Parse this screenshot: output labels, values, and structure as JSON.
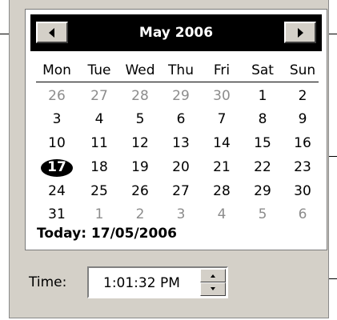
{
  "calendar": {
    "month_year": "May 2006",
    "prev_icon": "arrow-left-icon",
    "next_icon": "arrow-right-icon",
    "weekdays": [
      "Mon",
      "Tue",
      "Wed",
      "Thu",
      "Fri",
      "Sat",
      "Sun"
    ],
    "weeks": [
      [
        {
          "d": "26",
          "o": true
        },
        {
          "d": "27",
          "o": true
        },
        {
          "d": "28",
          "o": true
        },
        {
          "d": "29",
          "o": true
        },
        {
          "d": "30",
          "o": true
        },
        {
          "d": "1",
          "o": false
        },
        {
          "d": "2",
          "o": false
        }
      ],
      [
        {
          "d": "3",
          "o": false
        },
        {
          "d": "4",
          "o": false
        },
        {
          "d": "5",
          "o": false
        },
        {
          "d": "6",
          "o": false
        },
        {
          "d": "7",
          "o": false
        },
        {
          "d": "8",
          "o": false
        },
        {
          "d": "9",
          "o": false
        }
      ],
      [
        {
          "d": "10",
          "o": false
        },
        {
          "d": "11",
          "o": false
        },
        {
          "d": "12",
          "o": false
        },
        {
          "d": "13",
          "o": false
        },
        {
          "d": "14",
          "o": false
        },
        {
          "d": "15",
          "o": false
        },
        {
          "d": "16",
          "o": false
        }
      ],
      [
        {
          "d": "17",
          "o": false,
          "sel": true
        },
        {
          "d": "18",
          "o": false
        },
        {
          "d": "19",
          "o": false
        },
        {
          "d": "20",
          "o": false
        },
        {
          "d": "21",
          "o": false
        },
        {
          "d": "22",
          "o": false
        },
        {
          "d": "23",
          "o": false
        }
      ],
      [
        {
          "d": "24",
          "o": false
        },
        {
          "d": "25",
          "o": false
        },
        {
          "d": "26",
          "o": false
        },
        {
          "d": "27",
          "o": false
        },
        {
          "d": "28",
          "o": false
        },
        {
          "d": "29",
          "o": false
        },
        {
          "d": "30",
          "o": false
        }
      ],
      [
        {
          "d": "31",
          "o": false
        },
        {
          "d": "1",
          "o": true
        },
        {
          "d": "2",
          "o": true
        },
        {
          "d": "3",
          "o": true
        },
        {
          "d": "4",
          "o": true
        },
        {
          "d": "5",
          "o": true
        },
        {
          "d": "6",
          "o": true
        }
      ]
    ],
    "today_label": "Today: 17/05/2006"
  },
  "time": {
    "label": "Time:",
    "value": "1:01:32 PM",
    "spin_up_icon": "spin-up-icon",
    "spin_down_icon": "spin-down-icon"
  },
  "colors": {
    "header_bg": "#000000",
    "panel_bg": "#d4d0c8",
    "other_month_text": "#8c8c8c"
  }
}
